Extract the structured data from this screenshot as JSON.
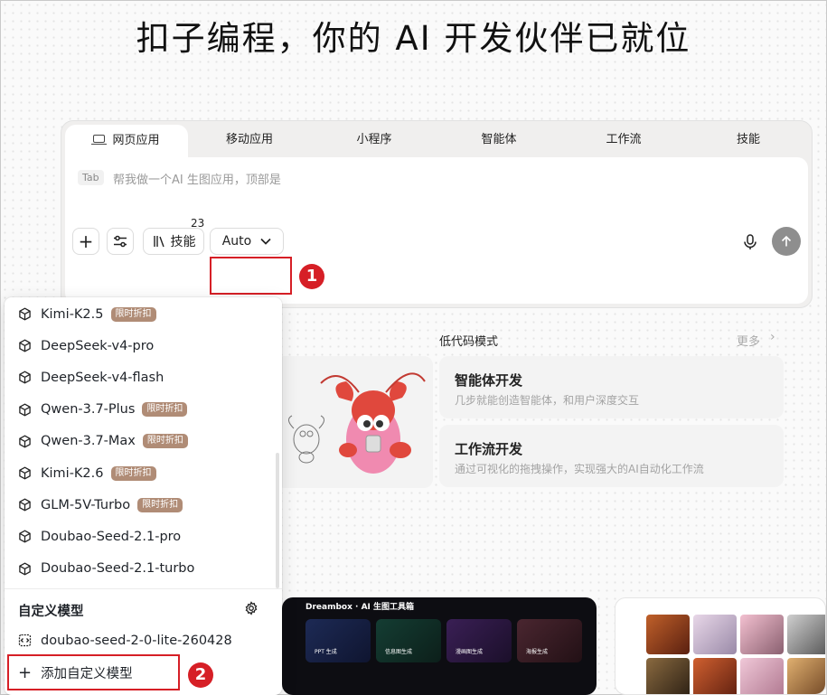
{
  "page_title": "扣子编程，你的 AI 开发伙伴已就位",
  "tabs": [
    {
      "label": "网页应用",
      "active": true
    },
    {
      "label": "移动应用",
      "active": false
    },
    {
      "label": "小程序",
      "active": false
    },
    {
      "label": "智能体",
      "active": false
    },
    {
      "label": "工作流",
      "active": false
    },
    {
      "label": "技能",
      "active": false
    }
  ],
  "prompt": {
    "tab_hint": "Tab",
    "placeholder": "帮我做一个AI 生图应用，顶部是"
  },
  "toolbar": {
    "add_label": "+",
    "skill_label": "技能",
    "skill_count": "23",
    "model_label": "Auto"
  },
  "annotations": {
    "one": "1",
    "two": "2"
  },
  "low_code": {
    "title": "低代码模式",
    "more": "更多",
    "cards": [
      {
        "title": "智能体开发",
        "desc": "几步就能创造智能体，和用户深度交互"
      },
      {
        "title": "工作流开发",
        "desc": "通过可视化的拖拽操作，实现强大的AI自动化工作流"
      }
    ]
  },
  "dropdown": {
    "models": [
      {
        "name": "Kimi-K2.5",
        "badge": "限时折扣"
      },
      {
        "name": "DeepSeek-v4-pro",
        "badge": null
      },
      {
        "name": "DeepSeek-v4-flash",
        "badge": null
      },
      {
        "name": "Qwen-3.7-Plus",
        "badge": "限时折扣"
      },
      {
        "name": "Qwen-3.7-Max",
        "badge": "限时折扣"
      },
      {
        "name": "Kimi-K2.6",
        "badge": "限时折扣"
      },
      {
        "name": "GLM-5V-Turbo",
        "badge": "限时折扣"
      },
      {
        "name": "Doubao-Seed-2.1-pro",
        "badge": null
      },
      {
        "name": "Doubao-Seed-2.1-turbo",
        "badge": null
      }
    ],
    "custom_section_title": "自定义模型",
    "custom_model": "doubao-seed-2-0-lite-260428",
    "add_custom_label": "添加自定义模型"
  },
  "showcase": {
    "dreambox_title": "Dreambox · AI 生图工具箱",
    "dreambox_cards": [
      {
        "label": "PPT 生成"
      },
      {
        "label": "信息图生成"
      },
      {
        "label": "漫画图生成"
      },
      {
        "label": "海报生成"
      }
    ]
  },
  "colors": {
    "annotation_red": "#d61f26",
    "badge_brown": "#b08c76",
    "send_button": "#8e8e8e"
  }
}
